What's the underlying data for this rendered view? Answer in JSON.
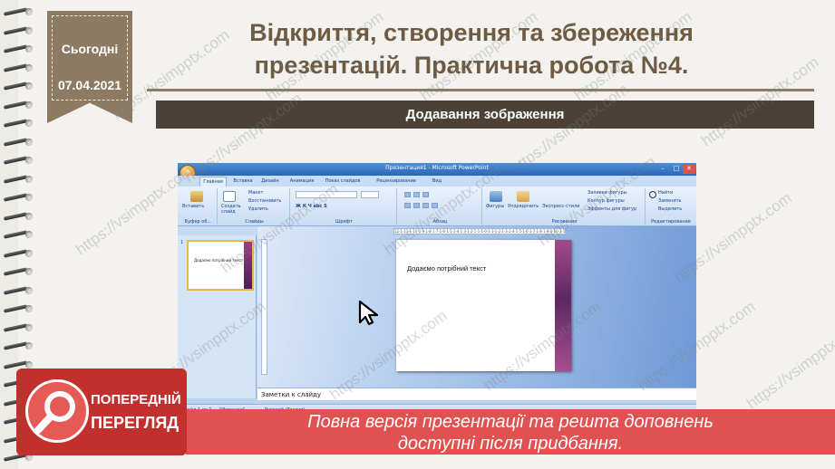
{
  "header": {
    "date_label": "Сьогодні",
    "date_value": "07.04.2021",
    "title_line1": "Відкриття, створення та збереження",
    "title_line2": "презентацій. Практична робота №4.",
    "subtitle": "Додавання зображення"
  },
  "ppt": {
    "window_title": "Презентация1 - Microsoft PowerPoint",
    "tabs": [
      "Главная",
      "Вставка",
      "Дизайн",
      "Анимация",
      "Показ слайдов",
      "Рецензирование",
      "Вид"
    ],
    "ribbon": {
      "paste_label": "Вставить",
      "create_slide_label": "Создать слайд",
      "layout_label": "Макет",
      "restore_label": "Восстановить",
      "delete_label": "Удалить",
      "clipboard_group": "Буфер об...",
      "slides_group": "Слайды",
      "font_group": "Шрифт",
      "paragraph_group": "Абзац",
      "figures_label": "Фигуры",
      "arrange_label": "Упорядочить",
      "express_styles_label": "Экспресс-стили",
      "fill_label": "Заливка фигуры",
      "outline_label": "Контур фигуры",
      "effects_label": "Эффекты для фигур",
      "drawing_group": "Рисование",
      "find_label": "Найти",
      "replace_label": "Заменить",
      "select_label": "Выделить",
      "editing_group": "Редактирование"
    },
    "thumbnail_number": "1",
    "thumbnail_text": "Додаємо потрібний текст",
    "slide_text": "Додаємо потрібний текст",
    "ruler_text": "12·1·11·1·10·1·9·1·8·1·7·1·6·1·5·1·4·1·3·1·2·1·1·1·0·1·1·1·2·1·3·1·4·1·5·1·6·1·7·1·8·1·9·1·10·1·11·1·12",
    "notes_placeholder": "Заметки к слайду",
    "status": {
      "slide_info": "Слайд 1 из 1",
      "theme": "\"Изящная\"",
      "language": "Русский (Россия)"
    }
  },
  "watermark": "https://vsimpptx.com",
  "preview": {
    "badge_line1": "ПОПЕРЕДНІЙ",
    "badge_line2": "ПЕРЕГЛЯД",
    "banner_line1": "Повна версія презентації та решта доповнень",
    "banner_line2": "доступні після придбання."
  }
}
